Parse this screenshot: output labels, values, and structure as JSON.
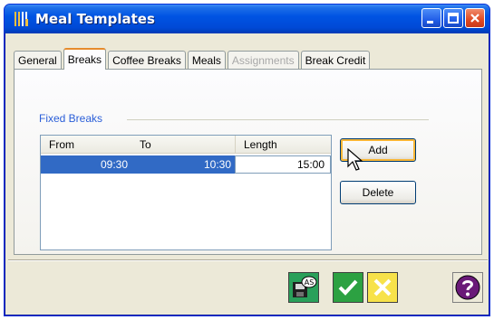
{
  "window": {
    "title": "Meal Templates",
    "title_icon": "fork-knife-icon",
    "controls": [
      "minimize-icon",
      "maximize-icon",
      "close-icon"
    ]
  },
  "tabs": [
    {
      "label": "General",
      "state": "normal"
    },
    {
      "label": "Breaks",
      "state": "active"
    },
    {
      "label": "Coffee Breaks",
      "state": "normal"
    },
    {
      "label": "Meals",
      "state": "normal"
    },
    {
      "label": "Assignments",
      "state": "disabled"
    },
    {
      "label": "Break Credit",
      "state": "normal"
    }
  ],
  "fixed_breaks": {
    "legend": "Fixed Breaks",
    "columns": {
      "from": "From",
      "to": "To",
      "length": "Length"
    },
    "rows": [
      {
        "from": "09:30",
        "to": "10:30",
        "length": "15:00"
      }
    ]
  },
  "buttons": {
    "add": "Add",
    "delete": "Delete"
  },
  "footer_buttons": [
    {
      "name": "save-as",
      "icon": "save-as-icon",
      "badge": "AS"
    },
    {
      "name": "ok",
      "icon": "checkmark-icon"
    },
    {
      "name": "cancel",
      "icon": "x-icon"
    },
    {
      "name": "help",
      "icon": "question-icon"
    }
  ],
  "colors": {
    "titlebar": "#0054e3",
    "selection": "#316ac5",
    "legend": "#2a5ed8",
    "ok_button": "#2ca142",
    "cancel_button": "#f7e24a",
    "save_button": "#29a05a"
  }
}
